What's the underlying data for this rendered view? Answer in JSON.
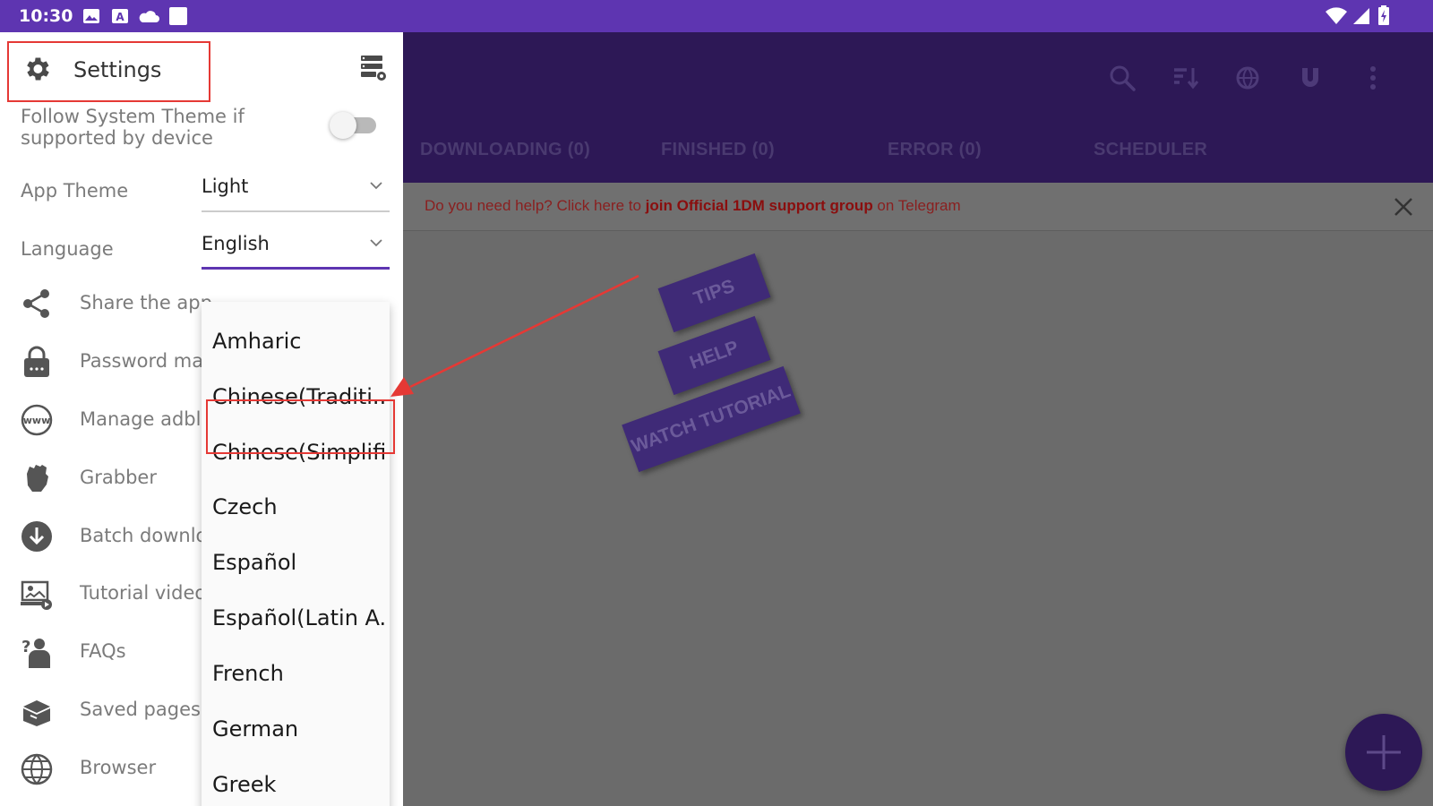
{
  "status_bar": {
    "time": "10:30"
  },
  "main": {
    "tabs": [
      "DOWNLOADING (0)",
      "FINISHED (0)",
      "ERROR (0)",
      "SCHEDULER"
    ],
    "banner": {
      "prefix": "Do you need help? Click here to ",
      "link": "join Official 1DM support group",
      "suffix": " on Telegram"
    },
    "tips": {
      "tips": "TIPS",
      "help": "HELP",
      "watch": "WATCH TUTORIAL"
    }
  },
  "drawer": {
    "title": "Settings",
    "follow_system_theme": "Follow System Theme if supported by device",
    "follow_system_theme_enabled": false,
    "app_theme": {
      "label": "App Theme",
      "value": "Light"
    },
    "language": {
      "label": "Language",
      "value": "English"
    },
    "menu": [
      {
        "label": "Share the app",
        "icon": "share-icon"
      },
      {
        "label": "Password man",
        "icon": "lock-icon"
      },
      {
        "label": "Manage adbloc",
        "icon": "www-icon"
      },
      {
        "label": "Grabber",
        "icon": "fist-icon"
      },
      {
        "label": "Batch downloa",
        "icon": "download-circle-icon"
      },
      {
        "label": "Tutorial video",
        "icon": "video-tutorial-icon"
      },
      {
        "label": "FAQs",
        "icon": "question-person-icon"
      },
      {
        "label": "Saved pages",
        "icon": "box-icon"
      },
      {
        "label": "Browser",
        "icon": "globe-icon"
      }
    ]
  },
  "language_options": [
    "Amharic",
    "Chinese(Traditi..",
    "Chinese(Simplifi..",
    "Czech",
    "Español",
    "Español(Latin A..",
    "French",
    "German",
    "Greek"
  ],
  "highlighted_option": "Chinese(Simplifi..",
  "colors": {
    "primary": "#5e35b1",
    "appbar_dim": "#2d1856",
    "annotation": "#e53935"
  }
}
